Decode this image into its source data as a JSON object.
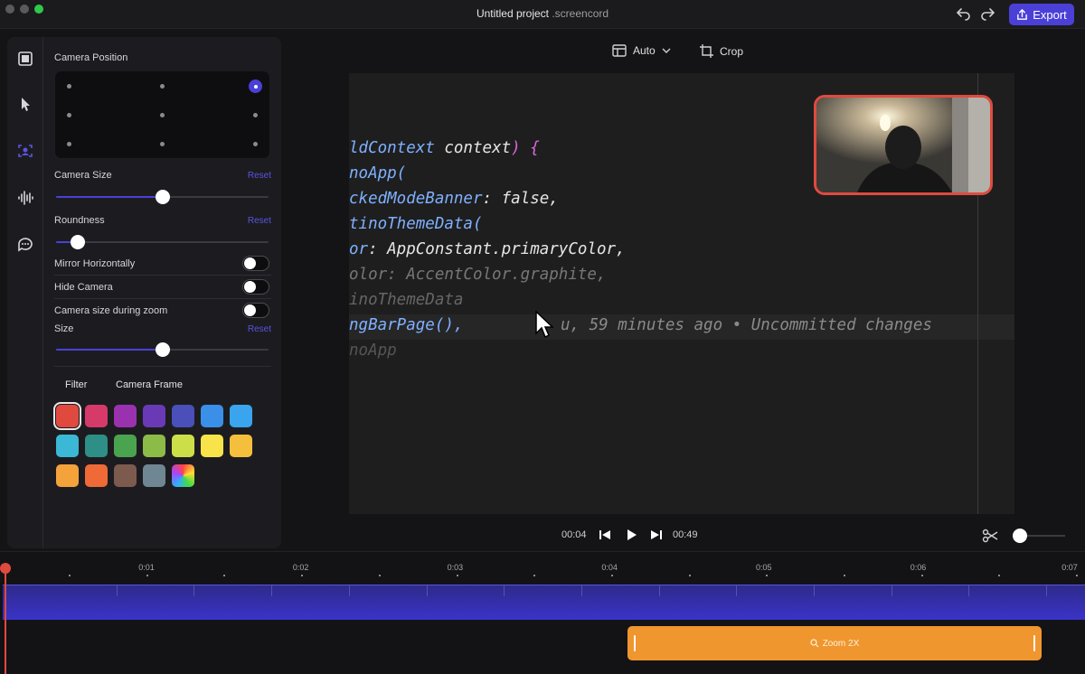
{
  "titlebar": {
    "project_name": "Untitled project",
    "project_ext": ".screencord",
    "export_label": "Export"
  },
  "panel": {
    "camera_position_label": "Camera Position",
    "camera_size_label": "Camera Size",
    "camera_size_reset": "Reset",
    "camera_size_value": 0.5,
    "roundness_label": "Roundness",
    "roundness_reset": "Reset",
    "roundness_value": 0.1,
    "mirror_label": "Mirror Horizontally",
    "hide_camera_label": "Hide Camera",
    "size_during_zoom_label": "Camera size during zoom",
    "size_label": "Size",
    "size_reset": "Reset",
    "size_value": 0.5,
    "tab_filter": "Filter",
    "tab_frame": "Camera Frame",
    "selected_position": "top-right",
    "frame_colors": [
      "#e04a3e",
      "#d63a6a",
      "#9a32b0",
      "#6a3ab6",
      "#4a4fba",
      "#3a8fe8",
      "#3aa4ee",
      "#3ab8d6",
      "#2d8f86",
      "#4aa34e",
      "#8dbb48",
      "#cddf48",
      "#f8e44a",
      "#f4bf3c",
      "#f4a23a",
      "#ef6a36",
      "#7d5a4e",
      "#6f8792",
      "gradient"
    ],
    "selected_frame_color": "#e04a3e"
  },
  "preview_controls": {
    "layout_label": "Auto",
    "crop_label": "Crop"
  },
  "code": {
    "lines": [
      {
        "t": "ldContext",
        "c": "#7fb0ff"
      },
      {
        "t": " context",
        "c": "#e6e6e6"
      },
      {
        "t": ") {",
        "c": "#d86ad8"
      },
      {
        "t": "noApp(",
        "c": "#7fb0ff"
      },
      {
        "t": "ckedModeBanner",
        "c": "#7fb0ff"
      },
      {
        "t": ": false,",
        "c": "#e6e6e6"
      },
      {
        "t": "tinoThemeData(",
        "c": "#7fb0ff"
      },
      {
        "t": "or",
        "c": "#7fb0ff"
      },
      {
        "t": ": AppConstant.primaryColor,",
        "c": "#e6e6e6"
      },
      {
        "t": "olor: AccentColor.graphite,",
        "c": "#777777"
      },
      {
        "t": "inoThemeData",
        "c": "#666666"
      },
      {
        "t": "ngBarPage(),",
        "c": "#7fb0ff"
      },
      {
        "t": "u, 59 minutes ago • Uncommitted changes",
        "c": "#8a8a8a"
      },
      {
        "t": "noApp",
        "c": "#555555"
      }
    ]
  },
  "playback": {
    "current_time": "00:04",
    "total_time": "00:49",
    "zoom_level": 0.0
  },
  "timeline": {
    "ticks": [
      "0:01",
      "0:02",
      "0:03",
      "0:04",
      "0:05",
      "0:06",
      "0:07"
    ],
    "zoom_clip_label": "Zoom 2X"
  },
  "colors": {
    "accent": "#4a40d8",
    "record": "#e04a3e",
    "zoom": "#f0962e"
  }
}
